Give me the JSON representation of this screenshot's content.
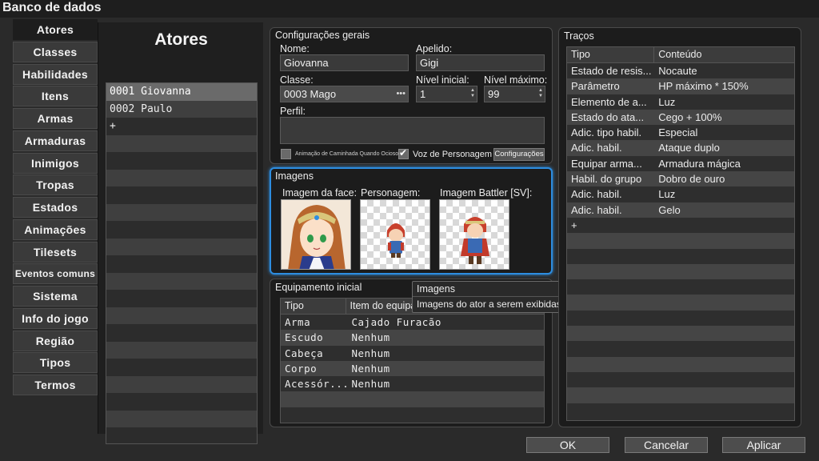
{
  "window": {
    "title": "Banco de dados"
  },
  "categories": [
    {
      "label": "Atores",
      "active": true
    },
    {
      "label": "Classes"
    },
    {
      "label": "Habilidades"
    },
    {
      "label": "Itens"
    },
    {
      "label": "Armas"
    },
    {
      "label": "Armaduras"
    },
    {
      "label": "Inimigos"
    },
    {
      "label": "Tropas"
    },
    {
      "label": "Estados"
    },
    {
      "label": "Animações"
    },
    {
      "label": "Tilesets"
    },
    {
      "label": "Eventos comuns"
    },
    {
      "label": "Sistema"
    },
    {
      "label": "Info do jogo"
    },
    {
      "label": "Região"
    },
    {
      "label": "Tipos"
    },
    {
      "label": "Termos"
    }
  ],
  "actors": {
    "title": "Atores",
    "items": [
      "0001 Giovanna",
      "0002 Paulo",
      "+"
    ],
    "selected": "0001 Giovanna"
  },
  "general": {
    "title": "Configurações gerais",
    "name_label": "Nome:",
    "name_value": "Giovanna",
    "nickname_label": "Apelido:",
    "nickname_value": "Gigi",
    "class_label": "Classe:",
    "class_value": "0003 Mago",
    "initial_level_label": "Nível inicial:",
    "initial_level_value": "1",
    "max_level_label": "Nível máximo:",
    "max_level_value": "99",
    "profile_label": "Perfil:",
    "profile_value": "",
    "walk_anim_label": "Animação de Caminhada Quando Ocioso",
    "walk_anim_checked": false,
    "voice_label": "Voz de Personagem",
    "voice_checked": true,
    "config_button": "Configurações"
  },
  "images": {
    "title": "Imagens",
    "face_label": "Imagem da face:",
    "character_label": "Personagem:",
    "battler_label": "Imagem Battler [SV]:"
  },
  "equipment": {
    "title": "Equipamento inicial",
    "headers": [
      "Tipo",
      "Item do equipamento"
    ],
    "rows": [
      [
        "Arma",
        "Cajado Furacão"
      ],
      [
        "Escudo",
        "Nenhum"
      ],
      [
        "Cabeça",
        "Nenhum"
      ],
      [
        "Corpo",
        "Nenhum"
      ],
      [
        "Acessór...",
        "Nenhum"
      ]
    ]
  },
  "tooltip": {
    "title": "Imagens",
    "body": "Imagens do ator a serem exibidas no jogo."
  },
  "traits": {
    "title": "Traços",
    "headers": [
      "Tipo",
      "Conteúdo"
    ],
    "rows": [
      [
        "Estado de resis...",
        "Nocaute"
      ],
      [
        "Parâmetro",
        "HP máximo * 150%"
      ],
      [
        "Elemento de a...",
        "Luz"
      ],
      [
        "Estado do ata...",
        "Cego + 100%"
      ],
      [
        "Adic. tipo habil.",
        "Especial"
      ],
      [
        "Adic. habil.",
        "Ataque duplo"
      ],
      [
        "Equipar arma...",
        "Armadura mágica"
      ],
      [
        "Habil. do grupo",
        "Dobro de ouro"
      ],
      [
        "Adic. habil.",
        "Luz"
      ],
      [
        "Adic. habil.",
        "Gelo"
      ],
      [
        "+",
        ""
      ]
    ]
  },
  "buttons": {
    "ok": "OK",
    "cancel": "Cancelar",
    "apply": "Aplicar"
  },
  "colors": {
    "accent": "#2d8de0",
    "window_bg": "#2a2a2a",
    "panel_bg": "#1c1c1c"
  }
}
